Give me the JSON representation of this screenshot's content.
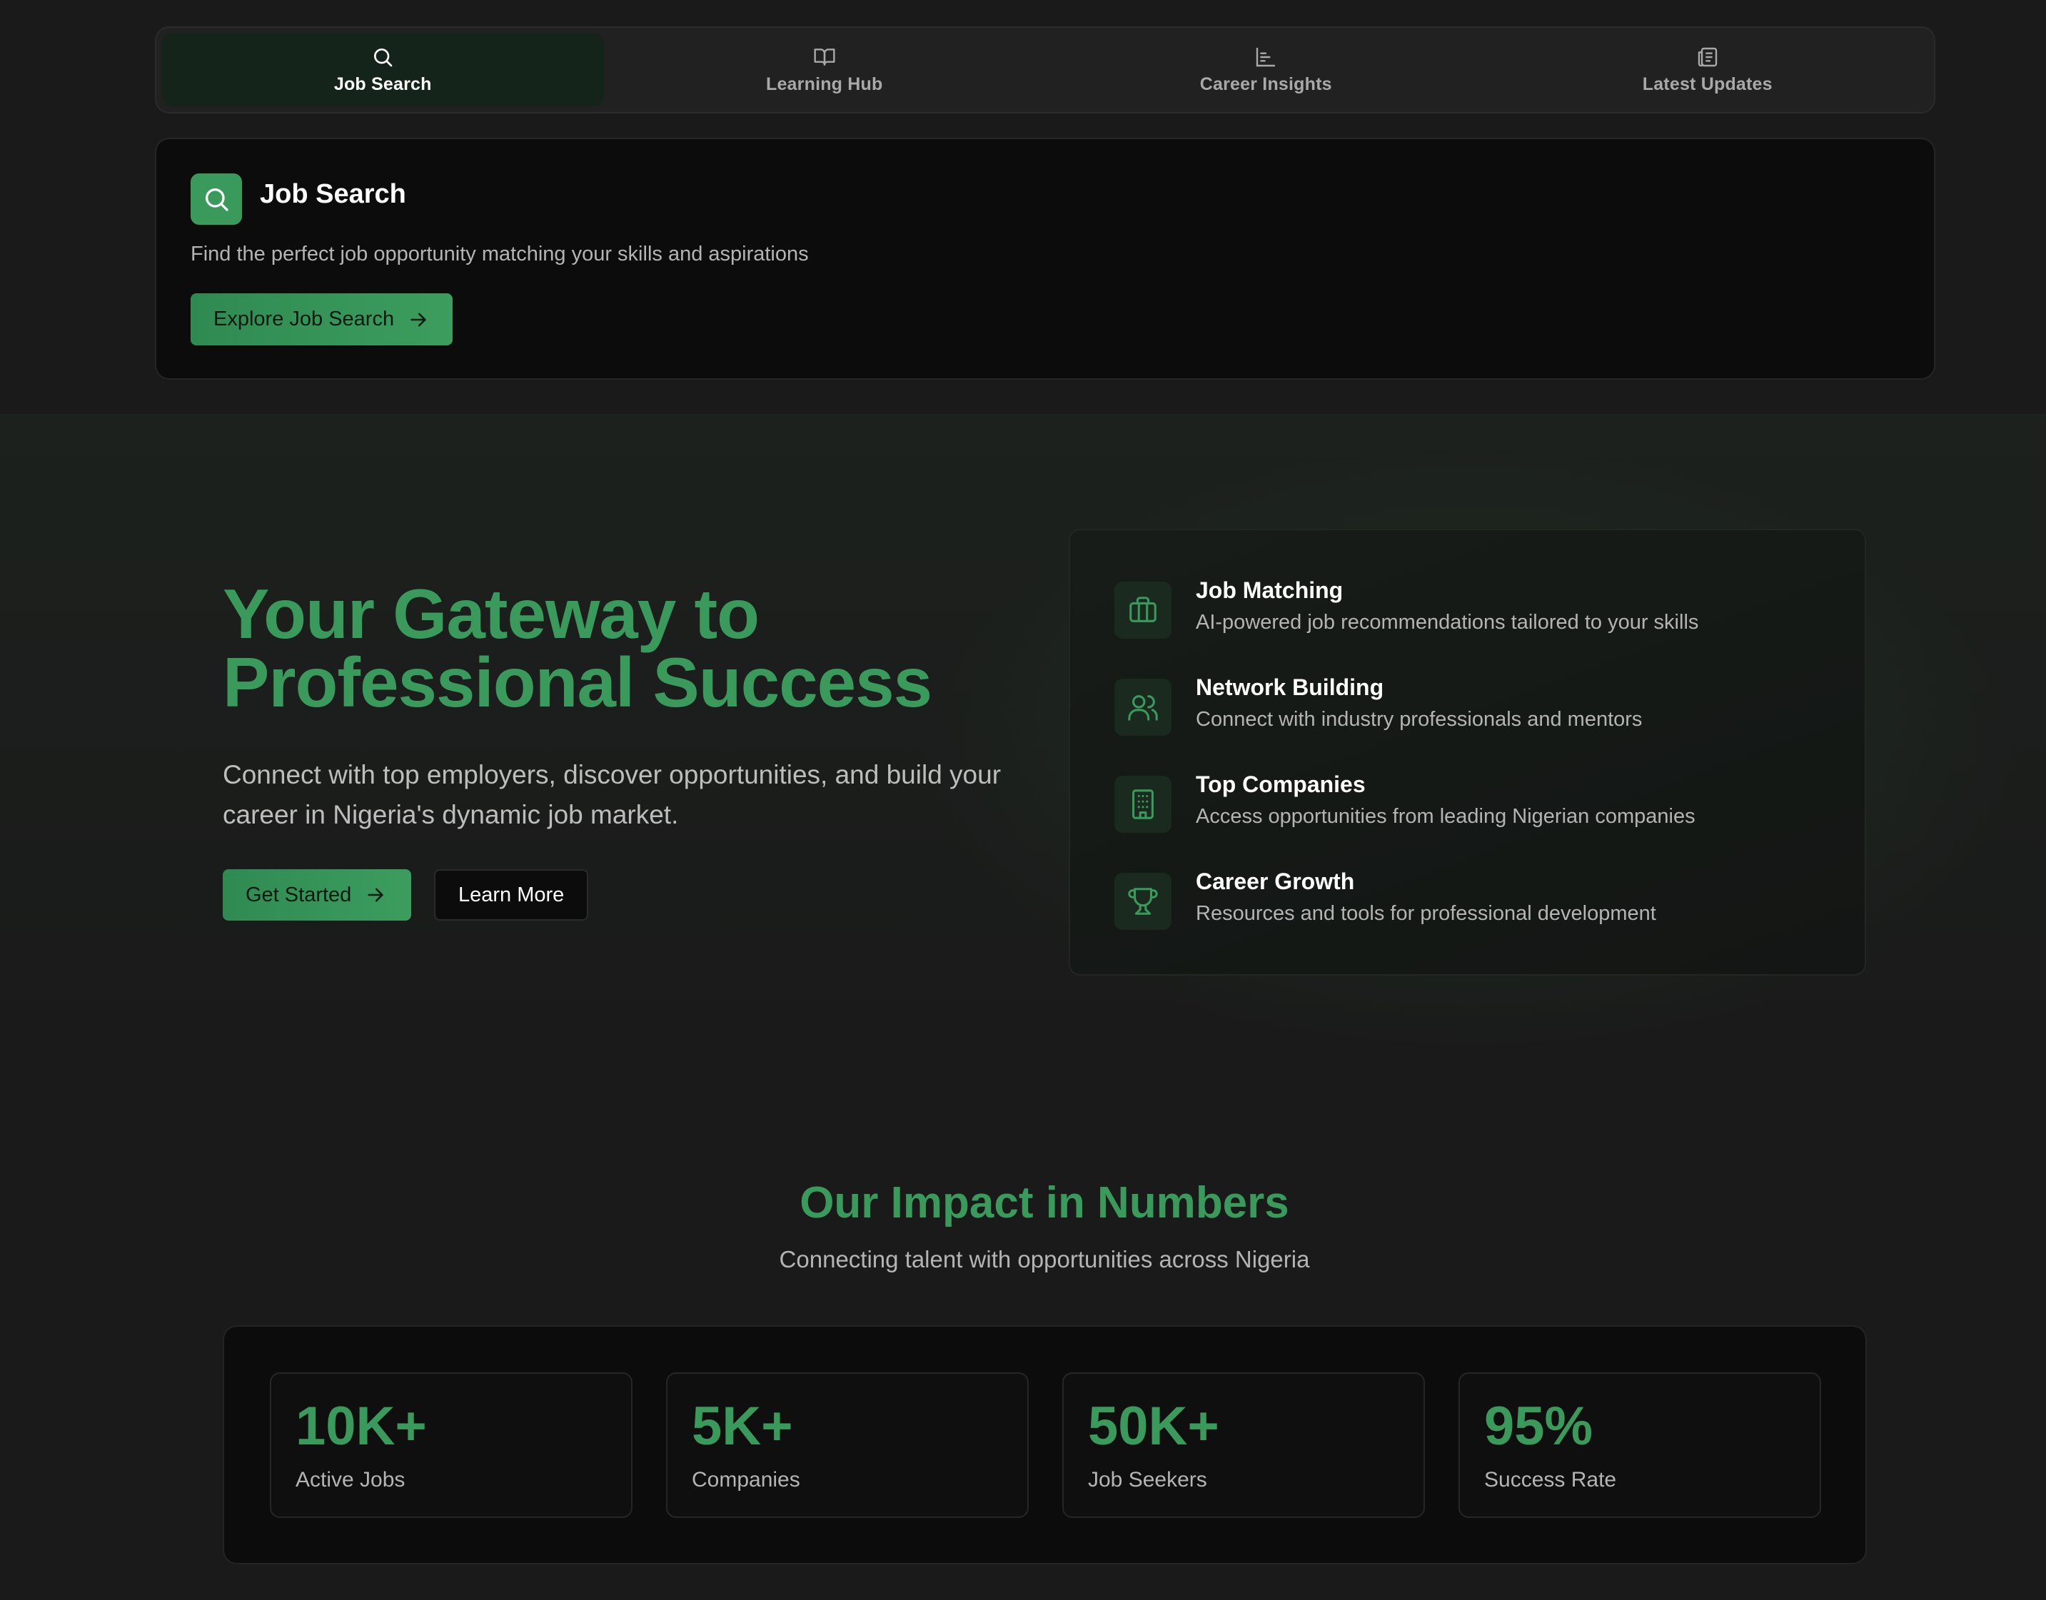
{
  "tabs": [
    {
      "label": "Job Search",
      "icon": "search-icon",
      "active": true
    },
    {
      "label": "Learning Hub",
      "icon": "book-open-icon",
      "active": false
    },
    {
      "label": "Career Insights",
      "icon": "bar-chart-icon",
      "active": false
    },
    {
      "label": "Latest Updates",
      "icon": "newspaper-icon",
      "active": false
    }
  ],
  "panel": {
    "icon": "search-icon",
    "title": "Job Search",
    "subtitle": "Find the perfect job opportunity matching your skills and aspirations",
    "button": "Explore Job Search"
  },
  "hero": {
    "title_line1": "Your Gateway to",
    "title_line2": "Professional Success",
    "subtitle": "Connect with top employers, discover opportunities, and build your career in Nigeria's dynamic job market.",
    "primary_button": "Get Started",
    "secondary_button": "Learn More"
  },
  "features": [
    {
      "icon": "briefcase-icon",
      "title": "Job Matching",
      "desc": "AI-powered job recommendations tailored to your skills"
    },
    {
      "icon": "users-icon",
      "title": "Network Building",
      "desc": "Connect with industry professionals and mentors"
    },
    {
      "icon": "building-icon",
      "title": "Top Companies",
      "desc": "Access opportunities from leading Nigerian companies"
    },
    {
      "icon": "trophy-icon",
      "title": "Career Growth",
      "desc": "Resources and tools for professional development"
    }
  ],
  "impact": {
    "title": "Our Impact in Numbers",
    "subtitle": "Connecting talent with opportunities across Nigeria",
    "stats": [
      {
        "value": "10K+",
        "label": "Active Jobs"
      },
      {
        "value": "5K+",
        "label": "Companies"
      },
      {
        "value": "50K+",
        "label": "Job Seekers"
      },
      {
        "value": "95%",
        "label": "Success Rate"
      }
    ]
  },
  "colors": {
    "accent": "#3a9a5c",
    "background": "#1a1a1a",
    "card": "#0c0c0c"
  }
}
